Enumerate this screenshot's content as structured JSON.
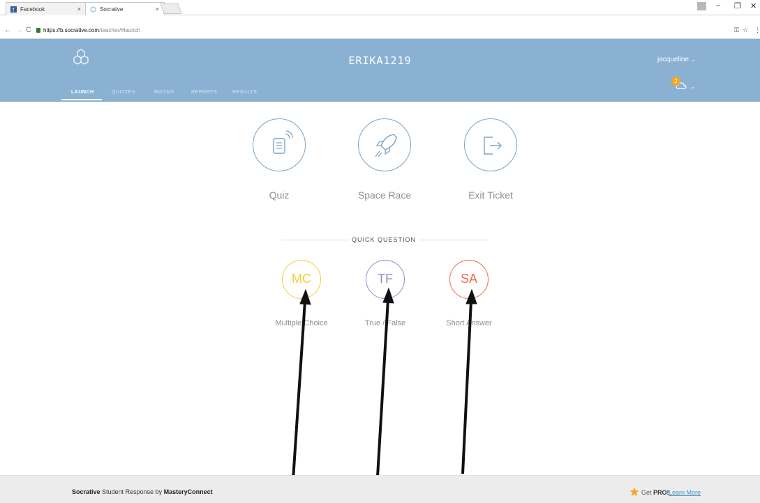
{
  "browser": {
    "tabs": [
      {
        "label": "Facebook",
        "active": false
      },
      {
        "label": "Socrative",
        "active": true
      }
    ],
    "url_host": "https://b.socrative.com",
    "url_path": "/teacher/#launch"
  },
  "header": {
    "room_name": "ERIKA1219",
    "user_name": "jacqueline",
    "notification_count": "2",
    "nav": [
      "LAUNCH",
      "QUIZZES",
      "ROOMS",
      "REPORTS",
      "RESULTS"
    ]
  },
  "activities": [
    {
      "label": "Quiz",
      "icon": "quiz-icon"
    },
    {
      "label": "Space Race",
      "icon": "rocket-icon"
    },
    {
      "label": "Exit Ticket",
      "icon": "exit-icon"
    }
  ],
  "quick_question": {
    "title": "QUICK QUESTION",
    "items": [
      {
        "abbr": "MC",
        "label": "Multiple Choice",
        "color": "#f2cf3a"
      },
      {
        "abbr": "TF",
        "label": "True / False",
        "color": "#9c86c9"
      },
      {
        "abbr": "SA",
        "label": "Short Answer",
        "color": "#ef6b4a"
      }
    ]
  },
  "footer": {
    "brand": "Socrative",
    "middle": " Student Response by ",
    "company": "MasteryConnect",
    "get": "Get ",
    "pro": "PRO!",
    "learn_more": "Learn More"
  },
  "colors": {
    "header_bg": "#8ab1d2",
    "circle_border": "#7aa3c4",
    "badge": "#f5a623"
  }
}
